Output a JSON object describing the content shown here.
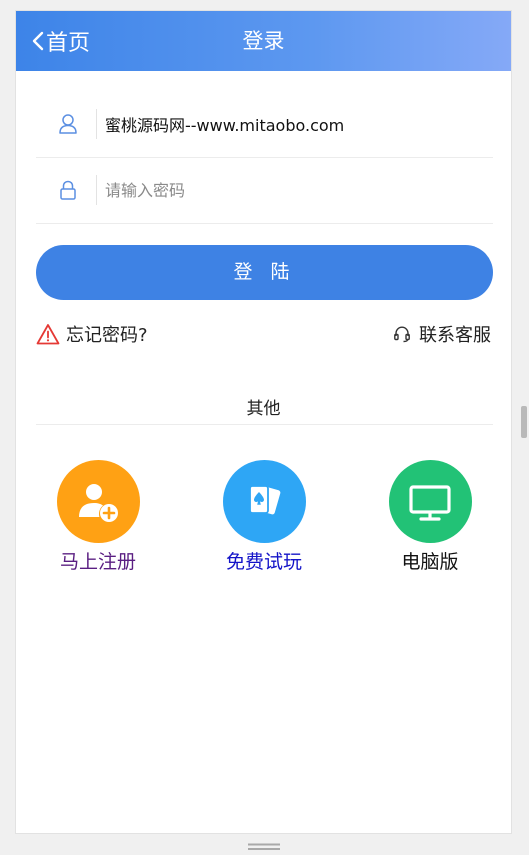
{
  "header": {
    "back_label": "首页",
    "title": "登录",
    "gradient_start": "#3d84e8",
    "gradient_end": "#85a9f7"
  },
  "form": {
    "username": {
      "value": "蜜桃源码网--www.mitaobo.com",
      "icon": "user-icon"
    },
    "password": {
      "value": "",
      "placeholder": "请输入密码",
      "icon": "lock-icon"
    },
    "login_button": "登 陆",
    "login_button_color": "#3e82e4"
  },
  "links": {
    "forgot_password": "忘记密码?",
    "forgot_icon": "warning-triangle-icon",
    "forgot_icon_color": "#e53935",
    "customer_service": "联系客服",
    "customer_service_icon": "headset-icon"
  },
  "other": {
    "title": "其他",
    "items": [
      {
        "label": "马上注册",
        "icon": "add-user-icon",
        "circle_color": "#ffa114",
        "label_color": "#5a1e82"
      },
      {
        "label": "免费试玩",
        "icon": "playing-cards-icon",
        "circle_color": "#2ea6f5",
        "label_color": "#1414c8"
      },
      {
        "label": "电脑版",
        "icon": "monitor-icon",
        "circle_color": "#22c276",
        "label_color": "#111111"
      }
    ]
  }
}
